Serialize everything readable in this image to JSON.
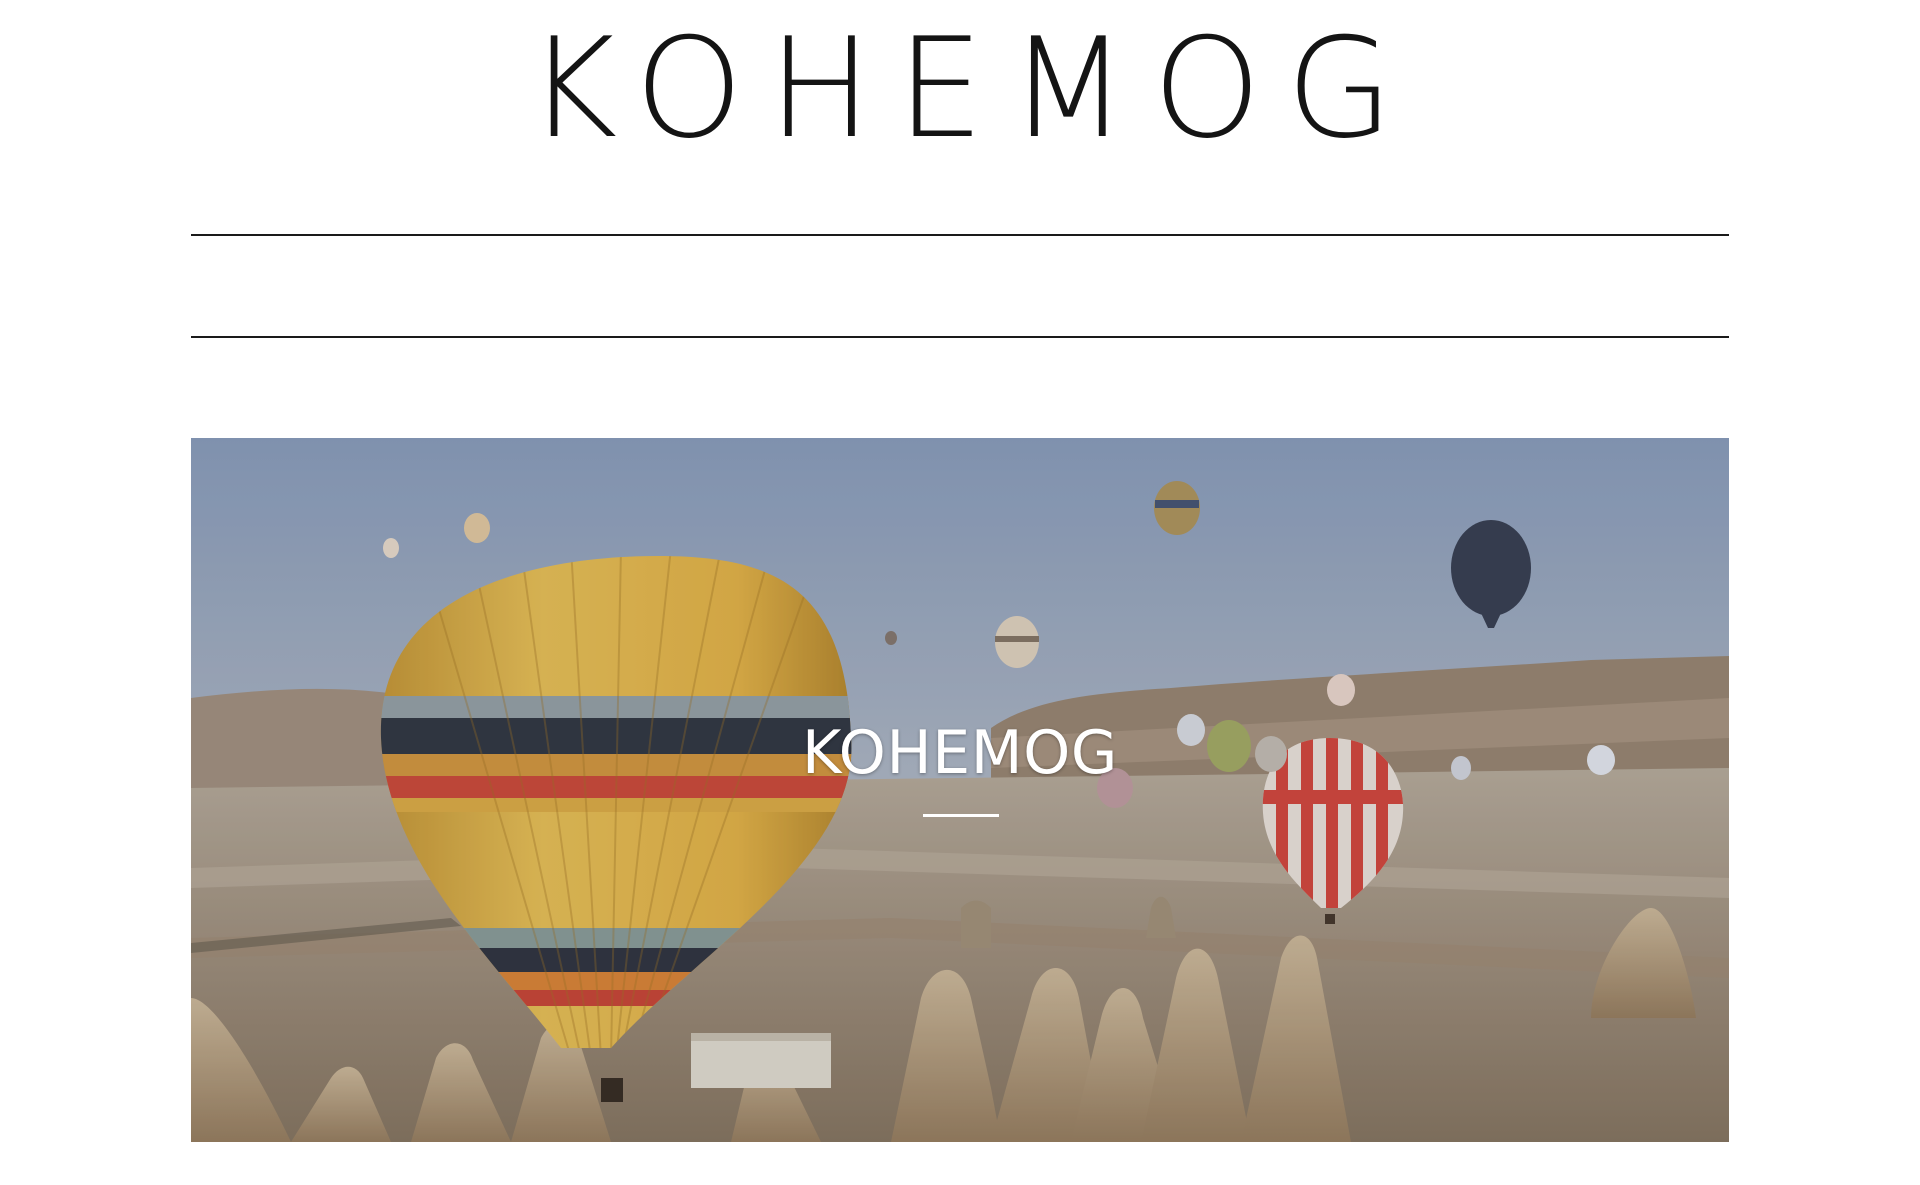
{
  "site": {
    "title": "KOHEMOG"
  },
  "hero": {
    "caption": "KOHEMOG",
    "image_subject": "hot-air-balloons-over-valley"
  },
  "colors": {
    "background": "#ffffff",
    "text": "#141414",
    "rule": "#1a1a1a",
    "caption": "#ffffff"
  }
}
